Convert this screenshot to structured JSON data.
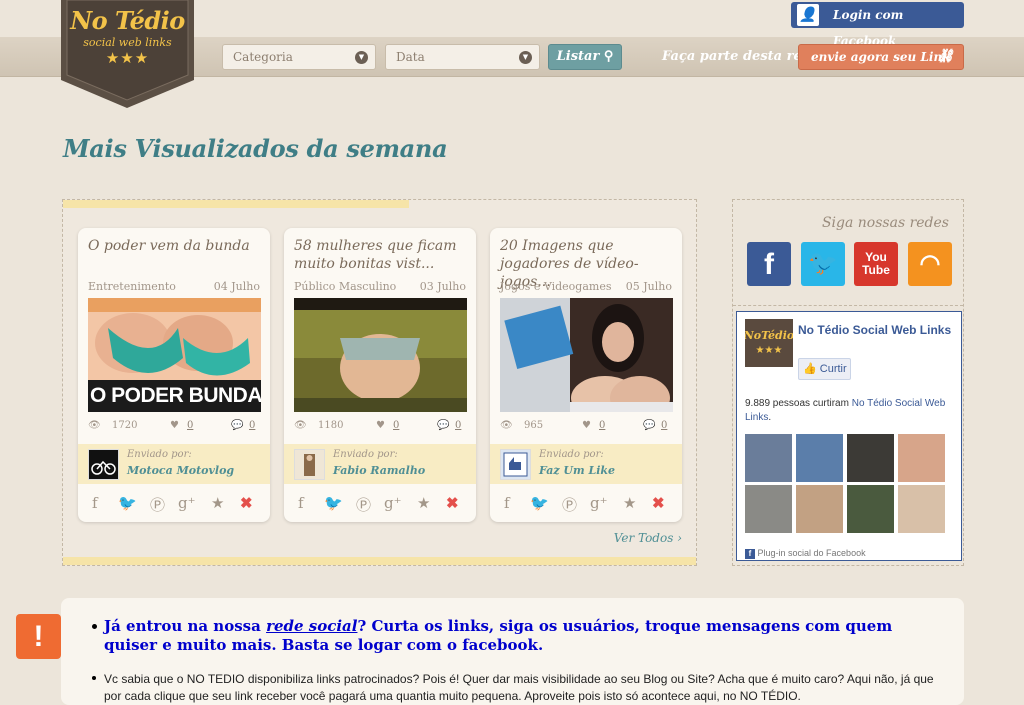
{
  "header": {
    "logo_title": "No Tédio",
    "logo_subtitle": "social web links",
    "logo_stars": "★★★",
    "category_select": "Categoria",
    "date_select": "Data",
    "list_button": "Listar",
    "join_text": "Faça parte desta rede",
    "send_button": "envie agora seu Link",
    "facebook_login": "Login com Facebook"
  },
  "main": {
    "heading": "Mais Visualizados da semana",
    "see_all": "Ver Todos ›",
    "cards": [
      {
        "title": "O poder vem da bunda",
        "category": "Entretenimento",
        "date": "04 Julho",
        "views": "1720",
        "likes": "0",
        "comments": "0",
        "sent_by_label": "Enviado por:",
        "sender": "Motoca Motovlog",
        "thumb_text": "O PODER BUNDA"
      },
      {
        "title": "58 mulheres que ficam muito bonitas vist...",
        "category": "Público Masculino",
        "date": "03 Julho",
        "views": "1180",
        "likes": "0",
        "comments": "0",
        "sent_by_label": "Enviado por:",
        "sender": "Fabio Ramalho"
      },
      {
        "title": "20 Imagens que jogadores de vídeo-jogos...",
        "category": "Jogos e Videogames",
        "date": "05 Julho",
        "views": "965",
        "likes": "0",
        "comments": "0",
        "sent_by_label": "Enviado por:",
        "sender": "Faz Um Like"
      }
    ]
  },
  "sidebar": {
    "follow_title": "Siga nossas redes",
    "socials": [
      "facebook-icon",
      "twitter-icon",
      "youtube-icon",
      "rss-icon"
    ],
    "fb_page_name": "No Tédio Social Web Links",
    "fb_like_button": "Curtir",
    "fb_count_text": "9.889 pessoas curtiram",
    "fb_count_link": "No Tédio Social Web Links",
    "fb_plugin": "Plug-in social do Facebook"
  },
  "notice": {
    "icon": "!",
    "big_part1": "Já entrou na nossa",
    "big_link": "rede social",
    "big_part2": "? Curta os links, siga os usuários, troque mensagens com quem quiser e muito mais. Basta se logar com o facebook.",
    "small": "Vc sabia que o NO TEDIO disponibiliza links patrocinados? Pois é! Quer dar mais visibilidade ao seu Blog ou Site? Acha que é muito caro? Aqui não, já que por cada clique que seu link receber você pagará uma quantia muito pequena. Aproveite pois isto só acontece aqui, no NO TÉDIO."
  },
  "colors": {
    "accent": "#3f7e86",
    "orange_button": "#e0805c",
    "facebook_blue": "#3b5a96",
    "highlight_band": "#f6e4a8"
  }
}
